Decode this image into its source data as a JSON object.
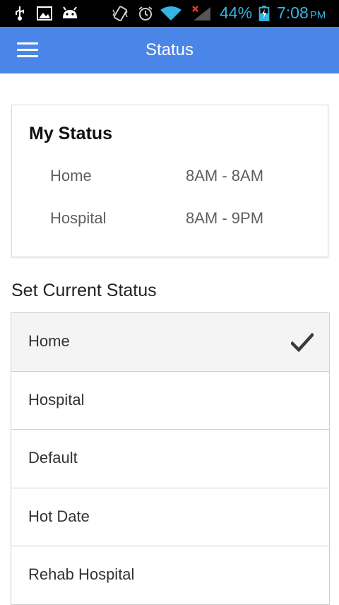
{
  "status_bar": {
    "battery_percent": "44%",
    "time": "7:08",
    "ampm": "PM",
    "icons": [
      "usb-icon",
      "gallery-icon",
      "android-icon",
      "vibrate-icon",
      "alarm-icon",
      "wifi-icon",
      "signal-no-service-icon",
      "battery-charging-icon"
    ],
    "accent_color": "#33b5e5"
  },
  "app_bar": {
    "title": "Status",
    "menu_icon": "hamburger-menu-icon",
    "color": "#4a86e8"
  },
  "my_status": {
    "title": "My Status",
    "rows": [
      {
        "name": "Home",
        "hours": "8AM - 8AM"
      },
      {
        "name": "Hospital",
        "hours": "8AM - 9PM"
      }
    ]
  },
  "set_status": {
    "title": "Set Current Status",
    "selected": "Home",
    "items": [
      {
        "label": "Home",
        "checked": true
      },
      {
        "label": "Hospital",
        "checked": false
      },
      {
        "label": "Default",
        "checked": false
      },
      {
        "label": "Hot Date",
        "checked": false
      },
      {
        "label": "Rehab Hospital",
        "checked": false
      }
    ]
  }
}
